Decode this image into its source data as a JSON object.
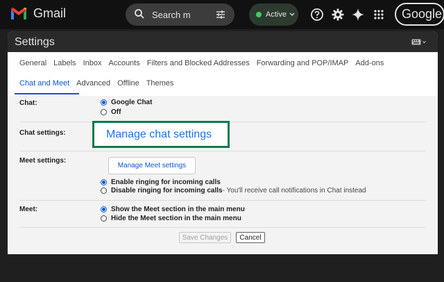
{
  "app": {
    "name": "Gmail"
  },
  "search": {
    "placeholder": "Search m"
  },
  "status": {
    "label": "Active",
    "color": "#3ccf5c"
  },
  "icons": [
    "gmail-logo-icon",
    "search-icon",
    "filter-icon",
    "help-icon",
    "gear-icon",
    "gemini-sparkle-icon",
    "apps-grid-icon",
    "keyboard-icon"
  ],
  "account": {
    "label": "Google"
  },
  "settings": {
    "title": "Settings",
    "tabs_row1": [
      "General",
      "Labels",
      "Inbox",
      "Accounts",
      "Filters and Blocked Addresses",
      "Forwarding and POP/IMAP",
      "Add-ons"
    ],
    "tabs_row2": [
      "Chat and Meet",
      "Advanced",
      "Offline",
      "Themes"
    ],
    "active_tab": "Chat and Meet"
  },
  "chat": {
    "label": "Chat:",
    "options": [
      "Google Chat",
      "Off"
    ],
    "selected": "Google Chat"
  },
  "chat_settings": {
    "label": "Chat settings:",
    "link": "Manage chat settings"
  },
  "meet_settings": {
    "label": "Meet settings:",
    "button": "Manage Meet settings",
    "option1": "Enable ringing for incoming calls",
    "option2": "Disable ringing for incoming calls",
    "option2_desc": " - You'll receive call notifications in Chat instead",
    "selected": "Enable ringing for incoming calls"
  },
  "meet": {
    "label": "Meet:",
    "option1": "Show the Meet section in the main menu",
    "option2": "Hide the Meet section in the main menu",
    "selected": "Show the Meet section in the main menu"
  },
  "actions": {
    "save": "Save Changes",
    "cancel": "Cancel"
  },
  "colors": {
    "accent": "#0b57d0",
    "highlight_border": "#0f7a4d",
    "topbar": "#111111"
  }
}
